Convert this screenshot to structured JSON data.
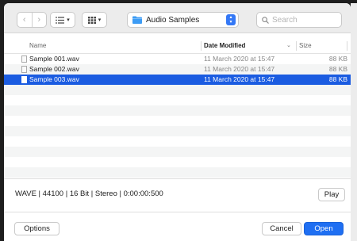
{
  "toolbar": {
    "path_popup_label": "Audio Samples",
    "search_placeholder": "Search"
  },
  "table": {
    "columns": {
      "name": "Name",
      "date_modified": "Date Modified",
      "size": "Size"
    },
    "rows": [
      {
        "name": "Sample 001.wav",
        "date": "11 March 2020 at 15:47",
        "size": "88 KB",
        "selected": false
      },
      {
        "name": "Sample 002.wav",
        "date": "11 March 2020 at 15:47",
        "size": "88 KB",
        "selected": false
      },
      {
        "name": "Sample 003.wav",
        "date": "11 March 2020 at 15:47",
        "size": "88 KB",
        "selected": true
      }
    ]
  },
  "file_info": "WAVE  |  44100  |  16 Bit  |  Stereo  |  0:00:00:500",
  "buttons": {
    "play": "Play",
    "options": "Options",
    "cancel": "Cancel",
    "open": "Open"
  },
  "colors": {
    "selection": "#1b5ce1",
    "accent": "#1f6ff2",
    "folder": "#3d9cf5"
  }
}
